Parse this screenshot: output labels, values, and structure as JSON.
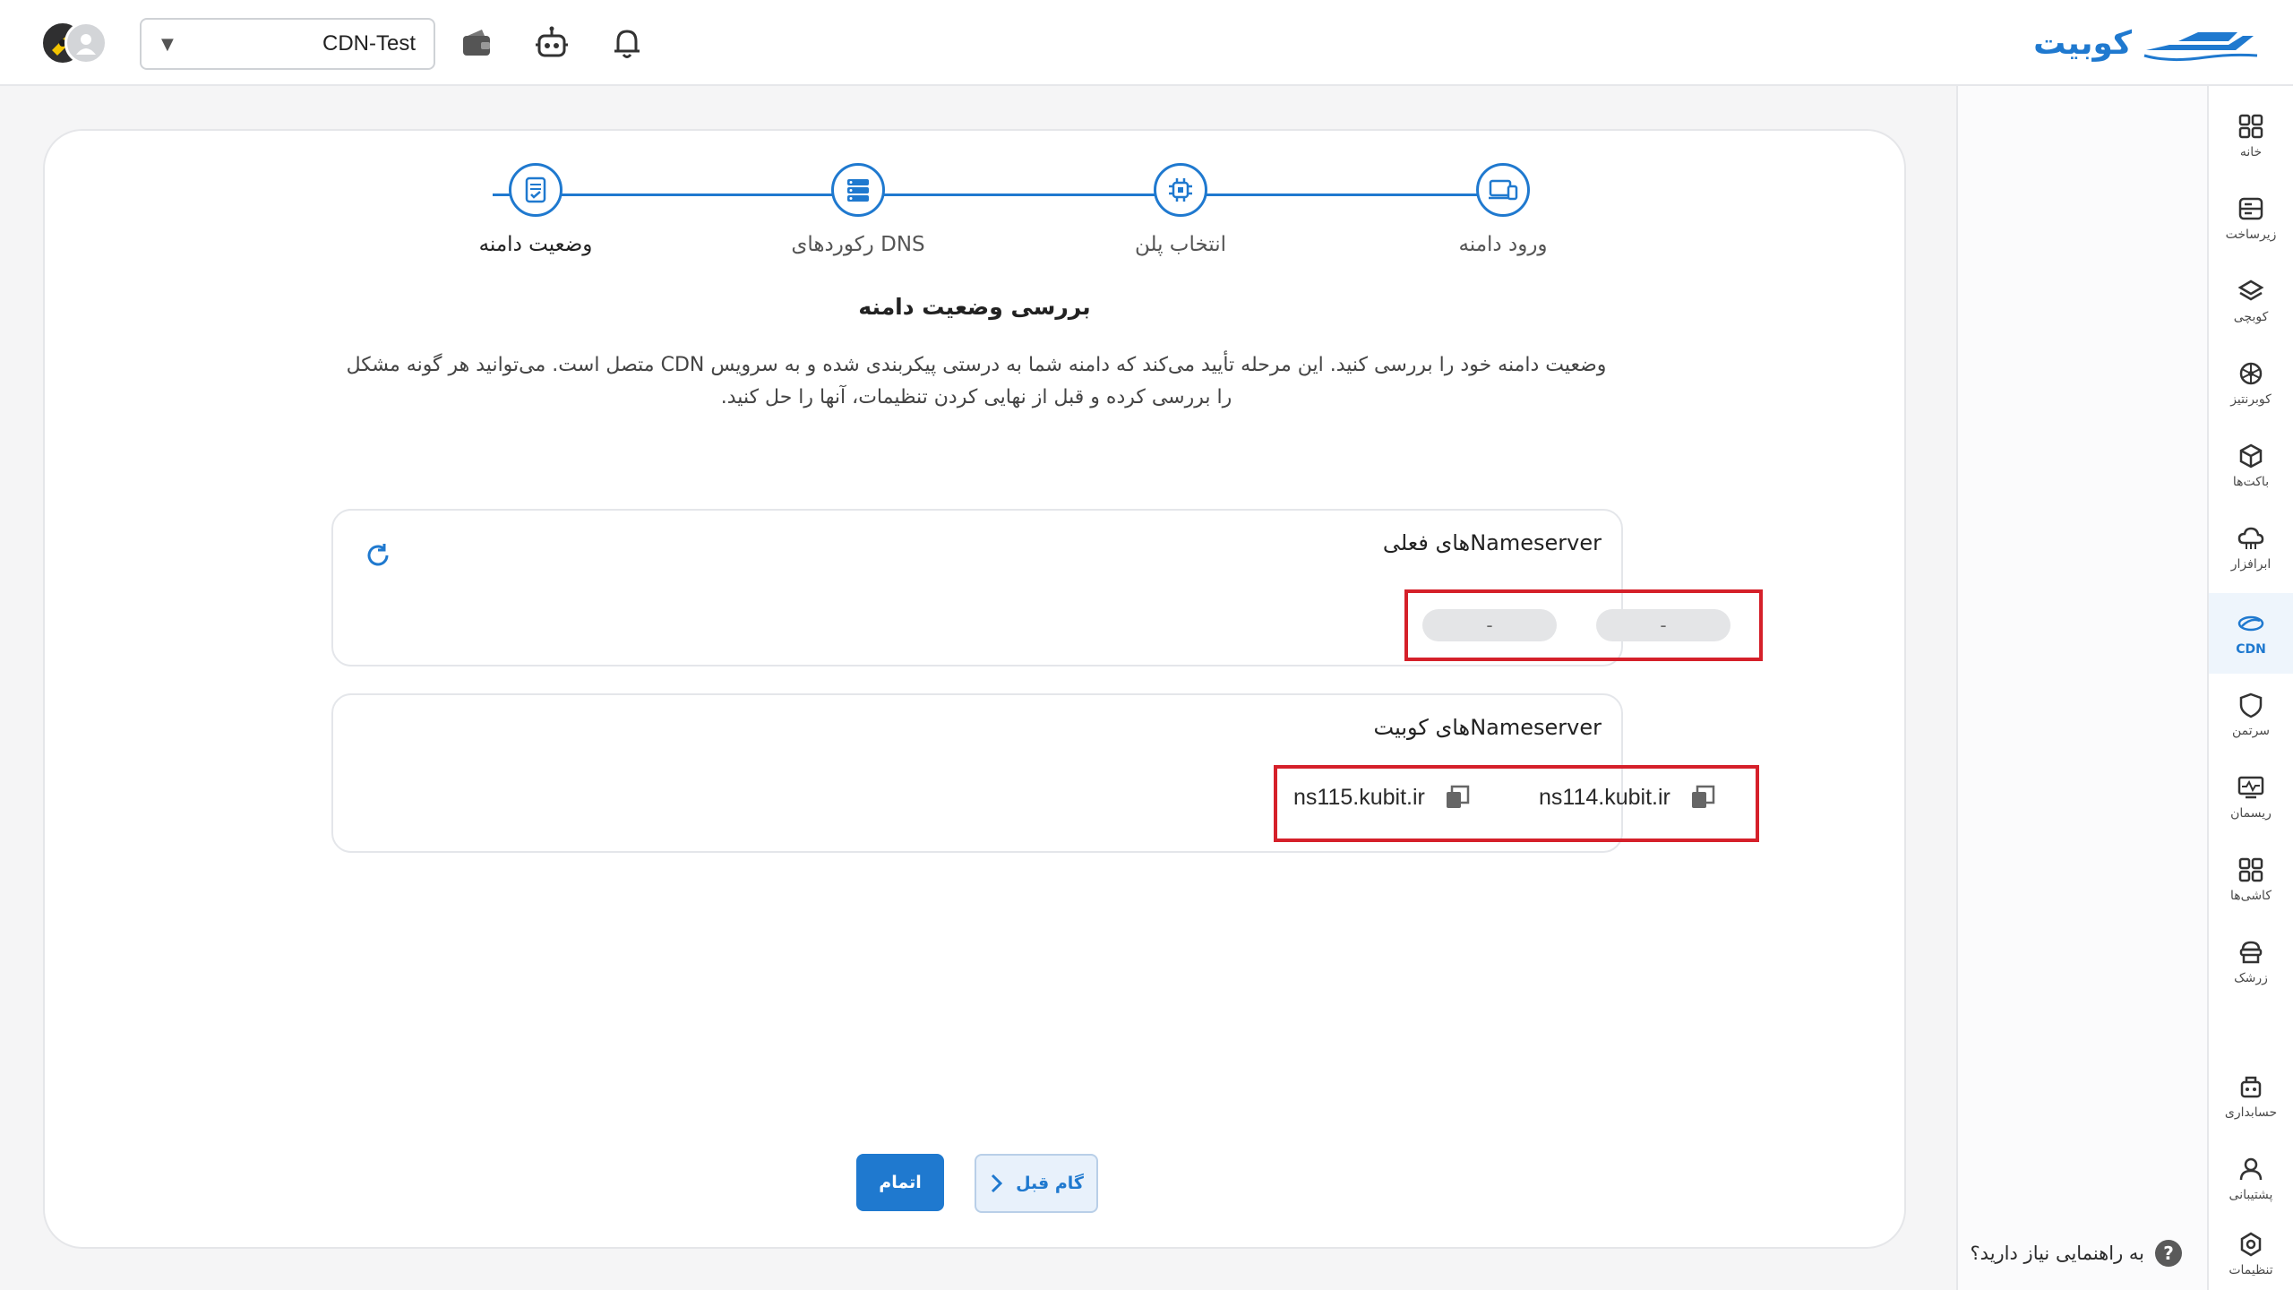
{
  "brand": {
    "name": "کوبیت"
  },
  "header": {
    "project": "CDN-Test",
    "icons": [
      "wallet-icon",
      "robot-icon",
      "bell-icon"
    ]
  },
  "sidebar": {
    "items": [
      {
        "label": "خانه",
        "icon": "home-grid-icon"
      },
      {
        "label": "زیرساخت",
        "icon": "server-icon"
      },
      {
        "label": "کوبچی",
        "icon": "layers-icon"
      },
      {
        "label": "کوبرنتیز",
        "icon": "kubernetes-icon"
      },
      {
        "label": "باکت‌ها",
        "icon": "box-icon"
      },
      {
        "label": "ابرافزار",
        "icon": "cloud-icon"
      },
      {
        "label": "CDN",
        "icon": "cdn-icon",
        "active": true
      },
      {
        "label": "سرتمن",
        "icon": "shield-icon"
      },
      {
        "label": "ریسمان",
        "icon": "monitor-icon"
      },
      {
        "label": "کاشی‌ها",
        "icon": "tiles-icon"
      },
      {
        "label": "زرشک",
        "icon": "doctor-icon"
      },
      {
        "label": "حسابداری",
        "icon": "accounting-icon"
      },
      {
        "label": "پشتیبانی",
        "icon": "support-icon"
      },
      {
        "label": "تنظیمات",
        "icon": "settings-icon"
      }
    ],
    "help": "به راهنمایی نیاز دارید؟"
  },
  "stepper": {
    "steps": [
      {
        "label": "ورود دامنه",
        "icon": "devices-icon"
      },
      {
        "label": "انتخاب پلن",
        "icon": "chip-icon"
      },
      {
        "label": "رکوردهای DNS",
        "icon": "records-icon"
      },
      {
        "label": "وضعیت دامنه",
        "icon": "document-check-icon"
      }
    ]
  },
  "content": {
    "title": "بررسی وضعیت دامنه",
    "description_line1": "وضعیت دامنه خود را بررسی کنید. این مرحله تأیید می‌کند که دامنه شما به درستی پیکربندی شده و به سرویس CDN متصل است. می‌توانید هر گونه مشکل",
    "description_line2": "را بررسی کرده و قبل از نهایی کردن تنظیمات، آنها را حل کنید."
  },
  "current_ns": {
    "title": "Nameserverهای فعلی",
    "values": [
      "-",
      "-"
    ]
  },
  "kubit_ns": {
    "title": "Nameserverهای کوبیت",
    "values": [
      "ns114.kubit.ir",
      "ns115.kubit.ir"
    ]
  },
  "actions": {
    "prev": "گام قبل",
    "finish": "اتمام"
  },
  "colors": {
    "accent": "#1f79cf",
    "highlight": "#d5202a"
  }
}
